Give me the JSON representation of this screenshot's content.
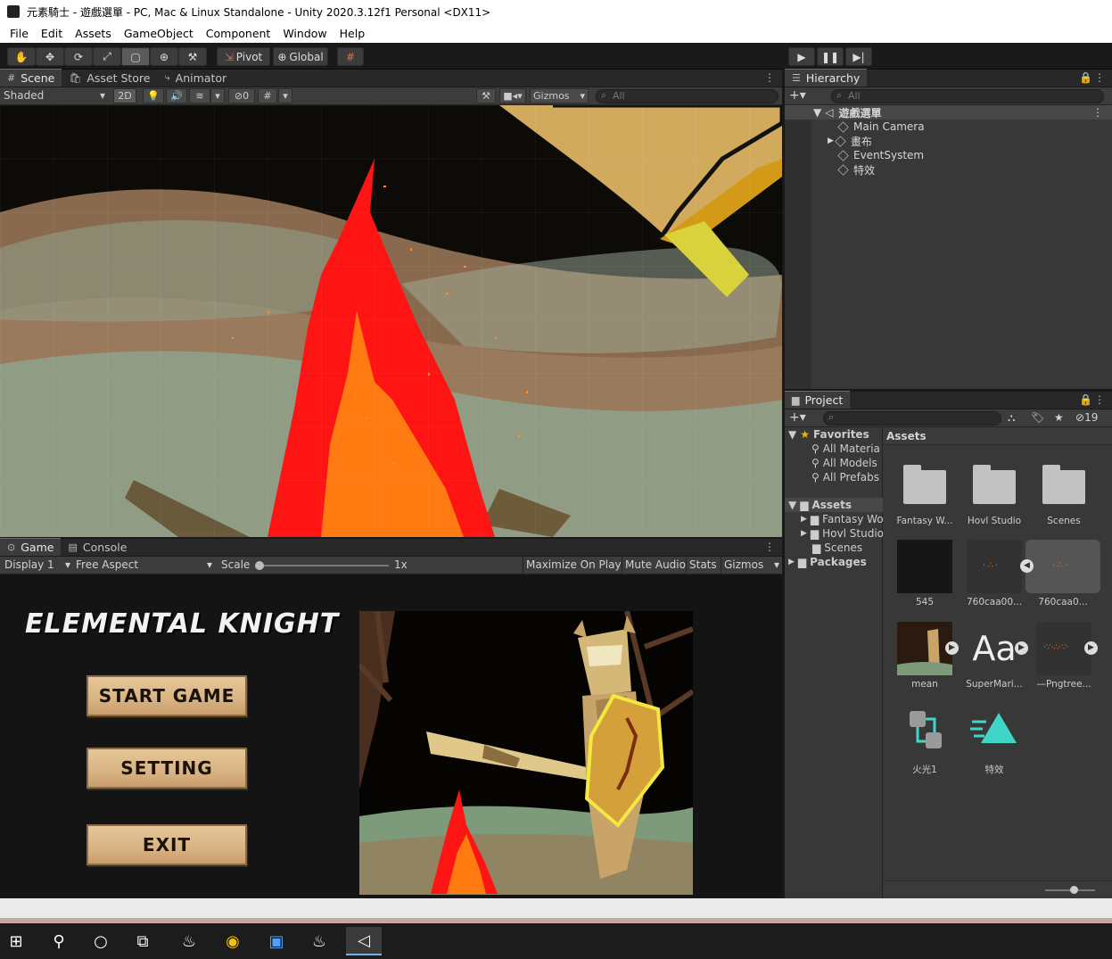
{
  "window": {
    "title": "元素騎士 - 遊戲選單 - PC, Mac & Linux Standalone - Unity 2020.3.12f1 Personal <DX11>"
  },
  "menu": [
    "File",
    "Edit",
    "Assets",
    "GameObject",
    "Component",
    "Window",
    "Help"
  ],
  "toolbar": {
    "pivot": "Pivot",
    "global": "Global",
    "tools": [
      "hand-tool-icon",
      "move-tool-icon",
      "rotate-tool-icon",
      "scale-tool-icon",
      "rect-tool-icon",
      "transform-tool-icon",
      "custom-tool-icon"
    ]
  },
  "scene_panel": {
    "tabs": [
      "Scene",
      "Asset Store",
      "Animator"
    ],
    "shading": "Shaded",
    "mode_2d": "2D",
    "hidden_count": "0",
    "gizmos": "Gizmos",
    "search_placeholder": "All"
  },
  "game_panel": {
    "tabs": [
      "Game",
      "Console"
    ],
    "display": "Display 1",
    "aspect": "Free Aspect",
    "scale_label": "Scale",
    "scale_value": "1x",
    "maximize": "Maximize On Play",
    "mute": "Mute Audio",
    "stats": "Stats",
    "gizmos": "Gizmos",
    "game_title": "ELEMENTAL KNIGHT",
    "buttons": [
      "START GAME",
      "SETTING",
      "EXIT"
    ]
  },
  "hierarchy": {
    "title": "Hierarchy",
    "search_placeholder": "All",
    "scene_name": "遊戲選單",
    "items": [
      "Main Camera",
      "畫布",
      "EventSystem",
      "特效"
    ]
  },
  "project": {
    "title": "Project",
    "hidden_count": "19",
    "favorites_label": "Favorites",
    "favorites": [
      "All Materia",
      "All Models",
      "All Prefabs"
    ],
    "assets_label": "Assets",
    "asset_tree": [
      "Fantasy Wo",
      "Hovl Studio",
      "Scenes"
    ],
    "packages_label": "Packages",
    "breadcrumb": "Assets",
    "grid": [
      {
        "name": "Fantasy W...",
        "kind": "folder"
      },
      {
        "name": "Hovl Studio",
        "kind": "folder"
      },
      {
        "name": "Scenes",
        "kind": "folder"
      },
      {
        "name": "545",
        "kind": "material"
      },
      {
        "name": "760caa00...",
        "kind": "particle"
      },
      {
        "name": "760caa0...",
        "kind": "particle-selected"
      },
      {
        "name": "mean",
        "kind": "image"
      },
      {
        "name": "SuperMari...",
        "kind": "font",
        "glyph": "Aa"
      },
      {
        "name": "—Pngtree...",
        "kind": "particle"
      },
      {
        "name": "火光1",
        "kind": "animator"
      },
      {
        "name": "特效",
        "kind": "animation"
      }
    ]
  },
  "colors": {
    "accent": "#5b9ad5",
    "panel": "#383838",
    "fire_red": "#ff1a1a",
    "fire_orange": "#ff7a10",
    "teal": "#3fd6c8"
  }
}
